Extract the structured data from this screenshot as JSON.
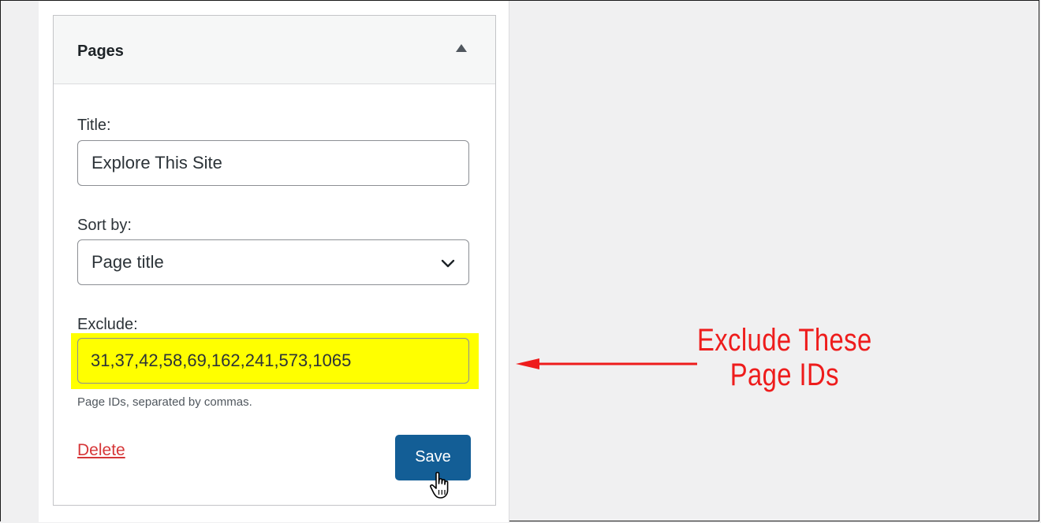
{
  "widget": {
    "title": "Pages",
    "toggle_icon": "triangle-up-icon"
  },
  "form": {
    "title_label": "Title:",
    "title_value": "Explore This Site",
    "sort_label": "Sort by:",
    "sort_value": "Page title",
    "exclude_label": "Exclude:",
    "exclude_value": "31,37,42,58,69,162,241,573,1065",
    "exclude_help": "Page IDs, separated by commas.",
    "delete_label": "Delete",
    "save_label": "Save"
  },
  "annotation": {
    "line1": "Exclude These",
    "line2": "Page IDs",
    "color": "#ee1c1c",
    "highlight_color": "#ffff00"
  },
  "colors": {
    "primary_button": "#135e96",
    "delete_link": "#d63638",
    "page_background": "#f0f0f1"
  }
}
